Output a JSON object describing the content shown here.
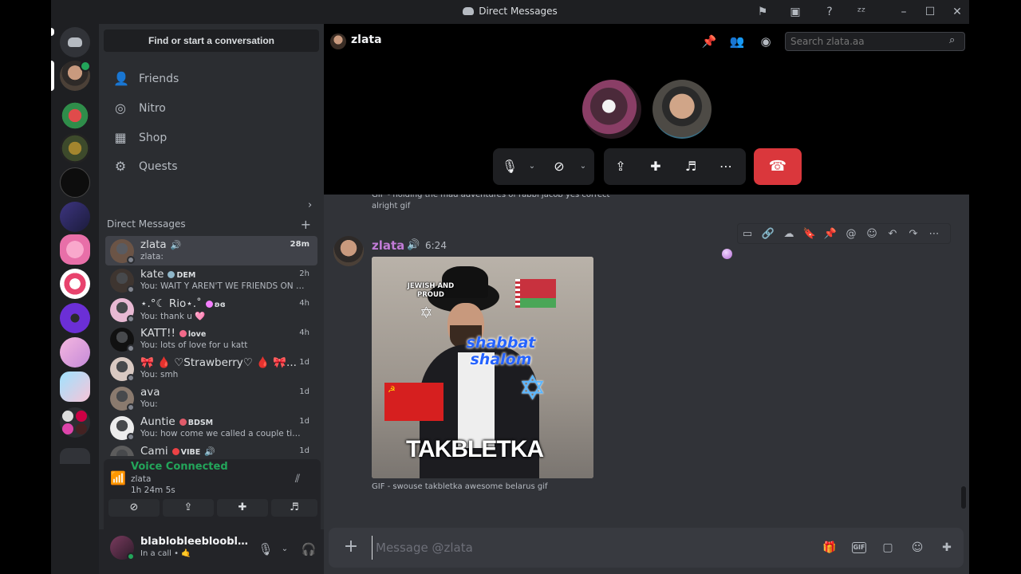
{
  "window": {
    "title": "Direct Messages"
  },
  "sidebar": {
    "find_label": "Find or start a conversation",
    "nav": [
      {
        "label": "Friends",
        "icon": "friends-icon"
      },
      {
        "label": "Nitro",
        "icon": "nitro-icon"
      },
      {
        "label": "Shop",
        "icon": "shop-icon"
      },
      {
        "label": "Quests",
        "icon": "quests-icon"
      }
    ],
    "dm_header": "Direct Messages",
    "dms": [
      {
        "name": "zlata",
        "sub": "zlata:",
        "time": "28m",
        "active": true,
        "speaker": true,
        "avatar_color": "#6b5446"
      },
      {
        "name": "kate",
        "tag": "DEM",
        "tag_color": "#8fb6c9",
        "sub": "You: WAIT Y AREN'T WE FRIENDS ON DISCORD",
        "time": "2h",
        "avatar_color": "#3e3530"
      },
      {
        "name": "⋆.°☾ Rio⋆.˚",
        "tag": "ʚɞ",
        "tag_color": "#f47fff",
        "sub": "You: thank u 🩷",
        "time": "4h",
        "avatar_color": "#e8b9d3"
      },
      {
        "name": "KATT!!",
        "tag": "love",
        "tag_color": "#f2698a",
        "sub": "You: lots of love for u katt",
        "time": "4h",
        "avatar_color": "#111111"
      },
      {
        "name": "🎀 🩸 ♡Strawberry♡ 🩸 🎀...",
        "sub": "You: smh",
        "time": "1d",
        "avatar_color": "#d9c9c2"
      },
      {
        "name": "ava",
        "sub": "You:",
        "time": "1d",
        "avatar_color": "#8a7a6e"
      },
      {
        "name": "Auntie",
        "tag": "BDSM",
        "tag_color": "#e05b6a",
        "sub": "You: how come we called a couple times, but we aren't friends",
        "time": "1d",
        "avatar_color": "#ececec"
      },
      {
        "name": "Cami",
        "tag": "VIBE",
        "tag_color": "#ed4245",
        "sub": "",
        "time": "1d",
        "speaker": true,
        "avatar_color": "#5c5c5c"
      }
    ],
    "voice": {
      "status": "Voice Connected",
      "channel": "zlata",
      "duration": "1h  24m  5s"
    },
    "user": {
      "name": "blablobleebloobleh...",
      "status": "In a call • 🤙"
    }
  },
  "header": {
    "channel_name": "zlata",
    "search_placeholder": "Search zlata.aa"
  },
  "messages": {
    "previous_caption": "GIF - holding the mad adventures of rabbi jacob yes correct alright gif",
    "author": "zlata",
    "time": "6:24",
    "gif": {
      "sticker_text": "JEWISH AND PROUD",
      "overlay_text": "shabbat shalom",
      "bottom_text": "TAKBLETKA"
    },
    "caption": "GIF - swouse takbletka awesome belarus gif"
  },
  "composer": {
    "placeholder": "Message @zlata"
  },
  "colors": {
    "accent_green": "#23a55a",
    "hangup_red": "#da373c",
    "author_color": "#c17bd6"
  }
}
